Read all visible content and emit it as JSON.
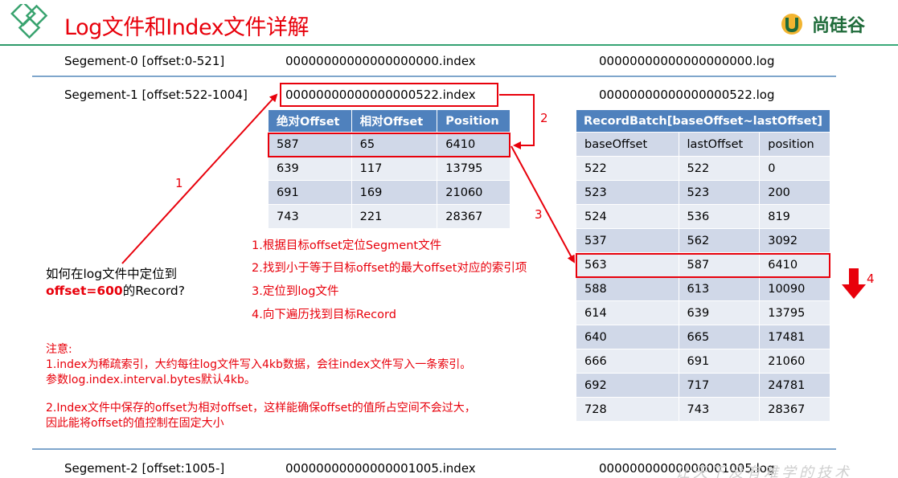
{
  "header": {
    "title": "Log文件和Index文件详解",
    "brand": "尚硅谷"
  },
  "segments": [
    {
      "label": "Segement-0 [offset:0-521]",
      "index_file": "00000000000000000000.index",
      "log_file": "00000000000000000000.log"
    },
    {
      "label": "Segement-1 [offset:522-1004]",
      "index_file": "00000000000000000522.index",
      "log_file": "00000000000000000522.log"
    },
    {
      "label": "Segement-2 [offset:1005-]",
      "index_file": "00000000000000001005.index",
      "log_file": "00000000000000001005.log"
    }
  ],
  "index_table": {
    "headers": [
      "绝对Offset",
      "相对Offset",
      "Position"
    ],
    "rows": [
      [
        "587",
        "65",
        "6410"
      ],
      [
        "639",
        "117",
        "13795"
      ],
      [
        "691",
        "169",
        "21060"
      ],
      [
        "743",
        "221",
        "28367"
      ]
    ]
  },
  "record_batch": {
    "title": "RecordBatch[baseOffset~lastOffset]",
    "headers": [
      "baseOffset",
      "lastOffset",
      "position"
    ],
    "rows": [
      [
        "522",
        "522",
        "0"
      ],
      [
        "523",
        "523",
        "200"
      ],
      [
        "524",
        "536",
        "819"
      ],
      [
        "537",
        "562",
        "3092"
      ],
      [
        "563",
        "587",
        "6410"
      ],
      [
        "588",
        "613",
        "10090"
      ],
      [
        "614",
        "639",
        "13795"
      ],
      [
        "640",
        "665",
        "17481"
      ],
      [
        "666",
        "691",
        "21060"
      ],
      [
        "692",
        "717",
        "24781"
      ],
      [
        "728",
        "743",
        "28367"
      ]
    ]
  },
  "step_numbers": [
    "1",
    "2",
    "3",
    "4"
  ],
  "question": {
    "line1": "如何在log文件中定位到",
    "line2_red": "offset=600",
    "line2_rest": "的Record?"
  },
  "steps": [
    "1.根据目标offset定位Segment文件",
    "2.找到小于等于目标offset的最大offset对应的索引项",
    "3.定位到log文件",
    "4.向下遍历找到目标Record"
  ],
  "notes": [
    "注意:",
    "1.index为稀疏索引，大约每往log文件写入4kb数据，会往index文件写入一条索引。",
    "参数log.index.interval.bytes默认4kb。",
    "2.Index文件中保存的offset为相对offset，这样能确保offset的值所占空间不会过大，",
    "因此能将offset的值控制在固定大小"
  ],
  "watermark": "让天下没有难学的技术",
  "colors": {
    "accent_red": "#e8000b",
    "header_blue": "#4f81bd",
    "row_odd": "#d0d8e8",
    "row_even": "#e9edf4",
    "brand_green": "#1f6b3a"
  }
}
